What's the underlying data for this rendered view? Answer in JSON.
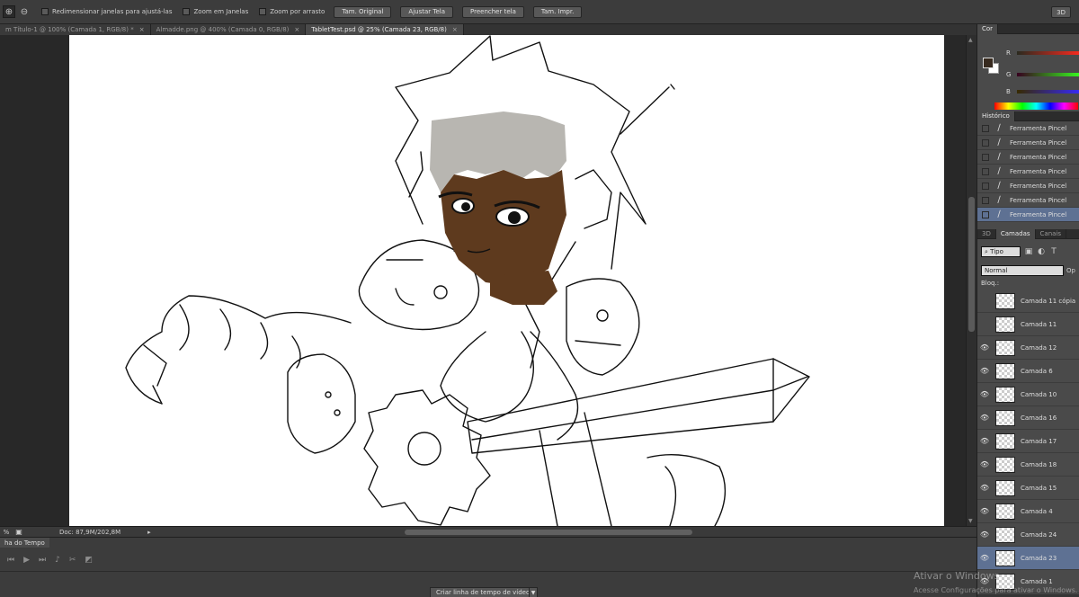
{
  "options": {
    "resize_label": "Redimensionar janelas para ajustá-las",
    "zoom_all_label": "Zoom em Janelas",
    "scrubby_label": "Zoom por arrasto",
    "buttons": [
      "Tam. Original",
      "Ajustar Tela",
      "Preencher tela",
      "Tam. Impr."
    ],
    "mode3d": "3D"
  },
  "tabs": [
    {
      "label": "m Título-1 @ 100% (Camada 1, RGB/8) *",
      "close": "×"
    },
    {
      "label": "Almadde.png @ 400% (Camada 0, RGB/8)",
      "close": "×"
    },
    {
      "label": "TabletTest.psd @ 25% (Camada 23, RGB/8)",
      "close": "×"
    }
  ],
  "status": {
    "zoom": "%",
    "doc": "Doc: 87,9M/202,8M",
    "arrow": "▸"
  },
  "timeline": {
    "title": "ha do Tempo",
    "create": "Criar linha de tempo de vídeo"
  },
  "color_panel": {
    "tab": "Cor",
    "r": "R",
    "g": "G",
    "b": "B",
    "fg": "#372a1f"
  },
  "history": {
    "tab": "Histórico",
    "items": [
      "Ferramenta Pincel",
      "Ferramenta Pincel",
      "Ferramenta Pincel",
      "Ferramenta Pincel",
      "Ferramenta Pincel",
      "Ferramenta Pincel",
      "Ferramenta Pincel"
    ]
  },
  "layers_panel": {
    "tabs": [
      "3D",
      "Camadas",
      "Canais"
    ],
    "kind": "Tipo",
    "blend": "Normal",
    "opacity": "Op",
    "lock": "Bloq.:",
    "layers": [
      {
        "name": "Camada 11 cópia",
        "visible": ""
      },
      {
        "name": "Camada 11",
        "visible": ""
      },
      {
        "name": "Camada 12",
        "visible": "👁"
      },
      {
        "name": "Camada 6",
        "visible": "👁"
      },
      {
        "name": "Camada 10",
        "visible": "👁"
      },
      {
        "name": "Camada 16",
        "visible": "👁"
      },
      {
        "name": "Camada 17",
        "visible": "👁"
      },
      {
        "name": "Camada 18",
        "visible": "👁"
      },
      {
        "name": "Camada 15",
        "visible": "👁"
      },
      {
        "name": "Camada 4",
        "visible": "👁"
      },
      {
        "name": "Camada 24",
        "visible": "👁"
      },
      {
        "name": "Camada 23",
        "visible": "👁"
      },
      {
        "name": "Camada 1",
        "visible": "👁"
      }
    ]
  },
  "watermark": {
    "line1": "Ativar o Windows",
    "line2": "Acesse Configurações para ativar o Windows."
  },
  "colors": {
    "skin": "#5e3a1e",
    "hair": "#b8b6b1",
    "accent": "#5e7193"
  }
}
